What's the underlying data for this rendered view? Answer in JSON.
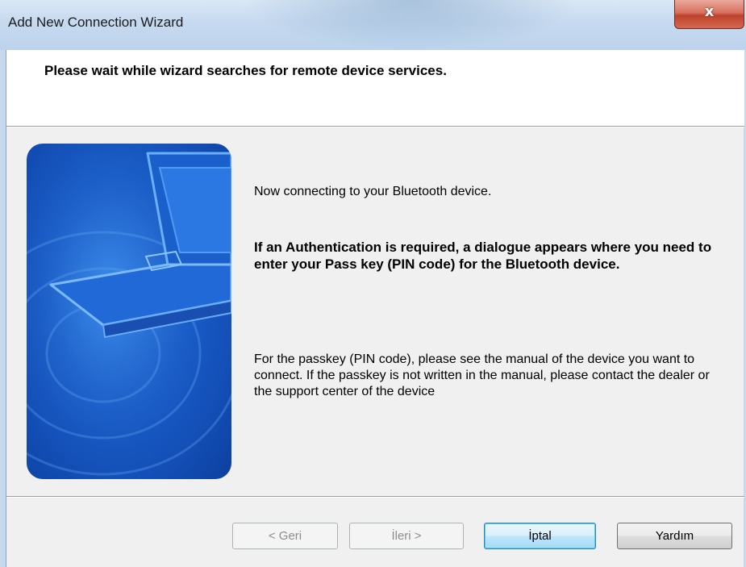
{
  "window": {
    "title": "Add New Connection Wizard",
    "close_glyph": "x"
  },
  "header": {
    "text": "Please wait while wizard searches for remote device services."
  },
  "content": {
    "line1": "Now connecting to your Bluetooth device.",
    "line2": "If an Authentication is required, a dialogue appears where you need to enter your Pass key (PIN code) for the Bluetooth device.",
    "line3": "For the passkey (PIN code), please see the manual of the device you want to connect. If the passkey is not written in the manual, please contact the dealer or the support center of the device"
  },
  "buttons": {
    "back": "< Geri",
    "next": "İleri >",
    "cancel": "İptal",
    "help": "Yardım"
  },
  "illustration": {
    "icon": "laptop-icon",
    "colors": {
      "blue": "#1a5fcf",
      "light": "#4a90ee"
    }
  }
}
